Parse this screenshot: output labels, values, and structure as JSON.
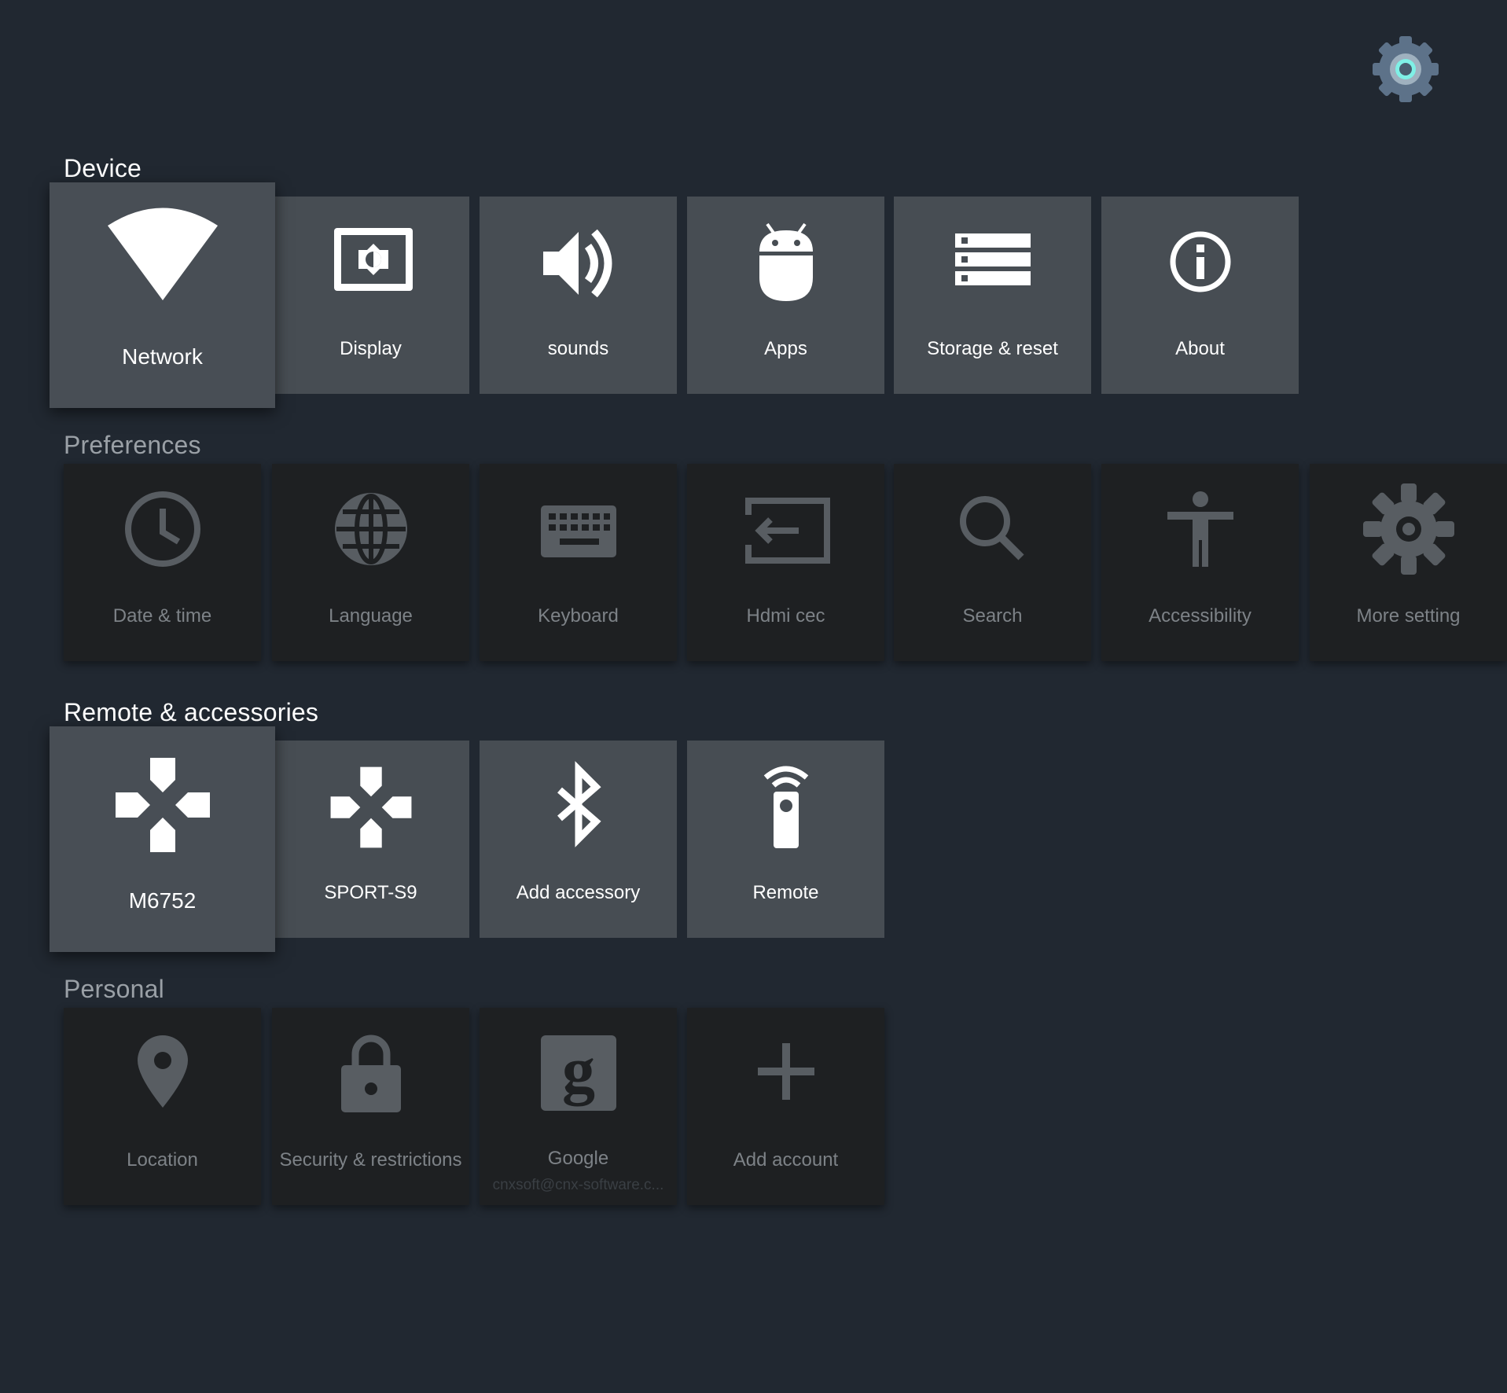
{
  "sections": {
    "device": {
      "title": "Device",
      "items": [
        {
          "label": "Network",
          "icon": "wifi-icon"
        },
        {
          "label": "Display",
          "icon": "display-icon"
        },
        {
          "label": "sounds",
          "icon": "volume-icon"
        },
        {
          "label": "Apps",
          "icon": "android-icon"
        },
        {
          "label": "Storage & reset",
          "icon": "storage-icon"
        },
        {
          "label": "About",
          "icon": "info-icon"
        }
      ]
    },
    "preferences": {
      "title": "Preferences",
      "items": [
        {
          "label": "Date & time",
          "icon": "clock-icon"
        },
        {
          "label": "Language",
          "icon": "globe-icon"
        },
        {
          "label": "Keyboard",
          "icon": "keyboard-icon"
        },
        {
          "label": "Hdmi cec",
          "icon": "input-icon"
        },
        {
          "label": "Search",
          "icon": "search-icon"
        },
        {
          "label": "Accessibility",
          "icon": "accessibility-icon"
        },
        {
          "label": "More setting",
          "icon": "gear-icon"
        }
      ]
    },
    "remote": {
      "title": "Remote & accessories",
      "items": [
        {
          "label": "M6752",
          "icon": "gamepad-icon"
        },
        {
          "label": "SPORT-S9",
          "icon": "gamepad-icon"
        },
        {
          "label": "Add accessory",
          "icon": "bluetooth-icon"
        },
        {
          "label": "Remote",
          "icon": "remote-icon"
        }
      ]
    },
    "personal": {
      "title": "Personal",
      "items": [
        {
          "label": "Location",
          "icon": "location-pin-icon"
        },
        {
          "label": "Security & restrictions",
          "icon": "lock-icon"
        },
        {
          "label": "Google",
          "sublabel": "cnxsoft@cnx-software.c...",
          "icon": "google-icon"
        },
        {
          "label": "Add account",
          "icon": "plus-icon"
        }
      ]
    }
  },
  "colors": {
    "background": "#212831",
    "tile_active": "#474d53",
    "tile_inactive": "#1e2022",
    "logo_accent": "#7ff0e6"
  }
}
